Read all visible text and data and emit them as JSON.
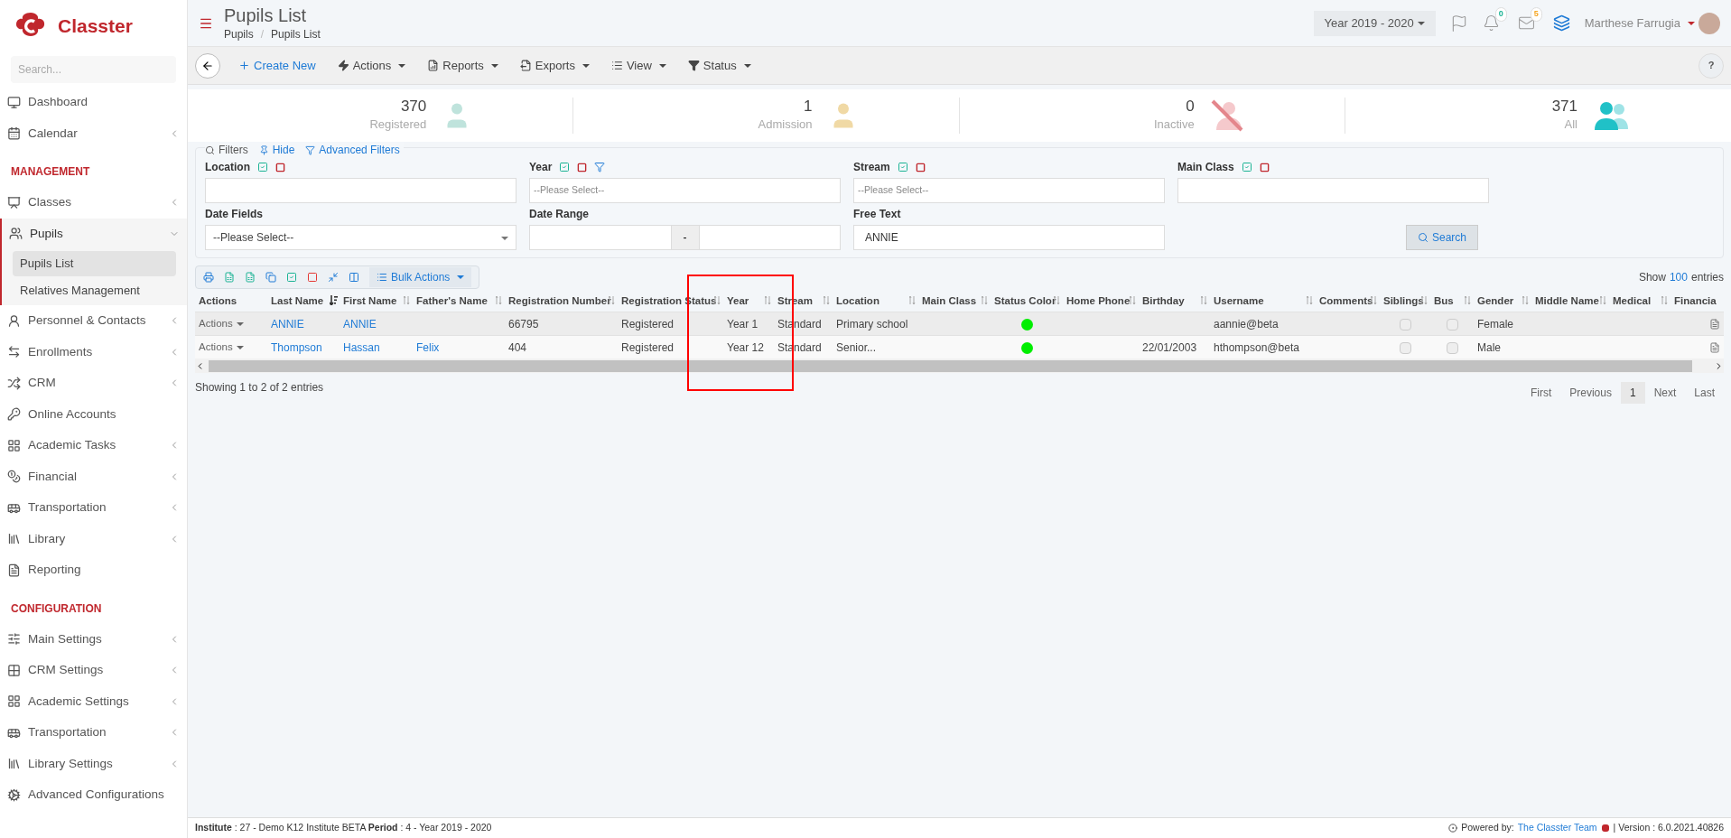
{
  "brand": {
    "name": "Classter"
  },
  "sidebar": {
    "search_placeholder": "Search...",
    "sections": [
      {
        "items": [
          {
            "label": "Dashboard",
            "expandable": false,
            "expanded": false,
            "selected": false
          },
          {
            "label": "Calendar",
            "expandable": true,
            "expanded": false,
            "selected": false
          }
        ]
      },
      {
        "heading": "MANAGEMENT",
        "items": [
          {
            "label": "Classes",
            "expandable": true,
            "expanded": false,
            "selected": false
          },
          {
            "label": "Pupils",
            "expandable": true,
            "expanded": true,
            "selected": false,
            "children": [
              {
                "label": "Pupils List",
                "selected": true
              },
              {
                "label": "Relatives Management",
                "selected": false
              }
            ]
          },
          {
            "label": "Personnel & Contacts",
            "expandable": true,
            "expanded": false,
            "selected": false
          },
          {
            "label": "Enrollments",
            "expandable": true,
            "expanded": false,
            "selected": false
          },
          {
            "label": "CRM",
            "expandable": true,
            "expanded": false,
            "selected": false
          },
          {
            "label": "Online Accounts",
            "expandable": false,
            "expanded": false,
            "selected": false
          },
          {
            "label": "Academic Tasks",
            "expandable": true,
            "expanded": false,
            "selected": false
          },
          {
            "label": "Financial",
            "expandable": true,
            "expanded": false,
            "selected": false
          },
          {
            "label": "Transportation",
            "expandable": true,
            "expanded": false,
            "selected": false
          },
          {
            "label": "Library",
            "expandable": true,
            "expanded": false,
            "selected": false
          },
          {
            "label": "Reporting",
            "expandable": false,
            "expanded": false,
            "selected": false
          }
        ]
      },
      {
        "heading": "CONFIGURATION",
        "items": [
          {
            "label": "Main Settings",
            "expandable": true,
            "expanded": false,
            "selected": false
          },
          {
            "label": "CRM Settings",
            "expandable": true,
            "expanded": false,
            "selected": false
          },
          {
            "label": "Academic Settings",
            "expandable": true,
            "expanded": false,
            "selected": false
          },
          {
            "label": "Transportation",
            "expandable": true,
            "expanded": false,
            "selected": false
          },
          {
            "label": "Library Settings",
            "expandable": true,
            "expanded": false,
            "selected": false
          },
          {
            "label": "Advanced Configurations",
            "expandable": false,
            "expanded": false,
            "selected": false
          }
        ]
      }
    ]
  },
  "header": {
    "title": "Pupils List",
    "breadcrumb": [
      "Pupils",
      "Pupils List"
    ],
    "breadcrumb_separator": "/",
    "year": "Year 2019 - 2020",
    "notifications": "0",
    "messages": "5",
    "user": "Marthese Farrugia"
  },
  "toolbar": [
    {
      "label": "Create New",
      "kind": "primary"
    },
    {
      "label": "Actions",
      "kind": "menu"
    },
    {
      "label": "Reports",
      "kind": "menu"
    },
    {
      "label": "Exports",
      "kind": "menu"
    },
    {
      "label": "View",
      "kind": "menu"
    },
    {
      "label": "Status",
      "kind": "menu"
    }
  ],
  "help": "?",
  "stats": [
    {
      "value": "370",
      "label": "Registered"
    },
    {
      "value": "1",
      "label": "Admission"
    },
    {
      "value": "0",
      "label": "Inactive"
    },
    {
      "value": "371",
      "label": "All"
    }
  ],
  "filters": {
    "links": [
      "Filters",
      "Hide",
      "Advanced Filters"
    ],
    "fields": [
      {
        "label": "Location",
        "kind": "text",
        "toggles": true,
        "funnel": false
      },
      {
        "label": "Year",
        "kind": "select",
        "placeholder": "--Please Select--",
        "toggles": true,
        "funnel": true
      },
      {
        "label": "Stream",
        "kind": "select",
        "placeholder": "--Please Select--",
        "toggles": true,
        "funnel": false
      },
      {
        "label": "Main Class",
        "kind": "text",
        "toggles": true,
        "funnel": false
      },
      {
        "label": "Date Fields",
        "kind": "dropdown",
        "value": "--Please Select--",
        "toggles": false,
        "funnel": false
      },
      {
        "label": "Date Range",
        "kind": "range",
        "separator": "-",
        "toggles": false,
        "funnel": false
      },
      {
        "label": "Free Text",
        "kind": "text",
        "value": "ANNIE",
        "toggles": false,
        "funnel": false
      }
    ],
    "search_button": "Search"
  },
  "table": {
    "bulk_actions": "Bulk Actions",
    "show": "Show",
    "page_size": "100",
    "entries": "entries",
    "columns": [
      {
        "label": "Actions",
        "sortable": false
      },
      {
        "label": "Last Name",
        "sortable": true,
        "sorted": true
      },
      {
        "label": "First Name",
        "sortable": true,
        "sorted": false
      },
      {
        "label": "Father's Name",
        "sortable": true,
        "sorted": false
      },
      {
        "label": "Registration Number",
        "sortable": true,
        "sorted": false
      },
      {
        "label": "Registration Status",
        "sortable": true,
        "sorted": false
      },
      {
        "label": "Year",
        "sortable": true,
        "sorted": false
      },
      {
        "label": "Stream",
        "sortable": true,
        "sorted": false
      },
      {
        "label": "Location",
        "sortable": true,
        "sorted": false
      },
      {
        "label": "Main Class",
        "sortable": true,
        "sorted": false
      },
      {
        "label": "Status Color",
        "sortable": true,
        "sorted": false
      },
      {
        "label": "Home Phone",
        "sortable": true,
        "sorted": false
      },
      {
        "label": "Birthday",
        "sortable": true,
        "sorted": false
      },
      {
        "label": "Username",
        "sortable": true,
        "sorted": false
      },
      {
        "label": "Comments",
        "sortable": true,
        "sorted": false
      },
      {
        "label": "Siblings",
        "sortable": true,
        "sorted": false
      },
      {
        "label": "Bus",
        "sortable": true,
        "sorted": false
      },
      {
        "label": "Gender",
        "sortable": true,
        "sorted": false
      },
      {
        "label": "Middle Name",
        "sortable": true,
        "sorted": false
      },
      {
        "label": "Medical",
        "sortable": true,
        "sorted": false
      },
      {
        "label": "Financia",
        "sortable": false
      }
    ],
    "rows": [
      {
        "cells": [
          {
            "kind": "menu",
            "text": "Actions"
          },
          {
            "kind": "link",
            "text": "ANNIE"
          },
          {
            "kind": "link",
            "text": "ANNIE"
          },
          {
            "kind": "empty"
          },
          {
            "kind": "text",
            "text": "66795"
          },
          {
            "kind": "text",
            "text": "Registered"
          },
          {
            "kind": "text",
            "text": "Year 1"
          },
          {
            "kind": "text",
            "text": "Standard"
          },
          {
            "kind": "text",
            "text": "Primary school"
          },
          {
            "kind": "empty"
          },
          {
            "kind": "dot",
            "color": "#00ee00"
          },
          {
            "kind": "empty"
          },
          {
            "kind": "empty"
          },
          {
            "kind": "text",
            "text": "aannie@beta"
          },
          {
            "kind": "empty"
          },
          {
            "kind": "checkbox",
            "checked": false
          },
          {
            "kind": "checkbox",
            "checked": false
          },
          {
            "kind": "text",
            "text": "Female"
          },
          {
            "kind": "empty"
          },
          {
            "kind": "empty"
          },
          {
            "kind": "doc"
          }
        ]
      },
      {
        "cells": [
          {
            "kind": "menu",
            "text": "Actions"
          },
          {
            "kind": "link",
            "text": "Thompson"
          },
          {
            "kind": "link",
            "text": "Hassan"
          },
          {
            "kind": "link",
            "text": "Felix"
          },
          {
            "kind": "text",
            "text": "404"
          },
          {
            "kind": "text",
            "text": "Registered"
          },
          {
            "kind": "text",
            "text": "Year 12"
          },
          {
            "kind": "text",
            "text": "Standard"
          },
          {
            "kind": "text",
            "text": "Senior..."
          },
          {
            "kind": "empty"
          },
          {
            "kind": "dot",
            "color": "#00ee00"
          },
          {
            "kind": "empty"
          },
          {
            "kind": "text",
            "text": "22/01/2003"
          },
          {
            "kind": "text",
            "text": "hthompson@beta"
          },
          {
            "kind": "empty"
          },
          {
            "kind": "checkbox",
            "checked": false
          },
          {
            "kind": "checkbox",
            "checked": false
          },
          {
            "kind": "text",
            "text": "Male"
          },
          {
            "kind": "empty"
          },
          {
            "kind": "empty"
          },
          {
            "kind": "doc"
          }
        ]
      }
    ],
    "summary": "Showing 1 to 2 of 2 entries",
    "pagination": [
      {
        "label": "First",
        "selected": false
      },
      {
        "label": "Previous",
        "selected": false
      },
      {
        "label": "1",
        "selected": true
      },
      {
        "label": "Next",
        "selected": false
      },
      {
        "label": "Last",
        "selected": false
      }
    ]
  },
  "footer": {
    "info": "**Institute** : 27 - Demo K12 Institute BETA **Period** : 4 - Year 2019 - 2020",
    "powered": "Powered by:",
    "team": "The Classter Team",
    "version": "| Version : 6.0.2021.40826"
  }
}
